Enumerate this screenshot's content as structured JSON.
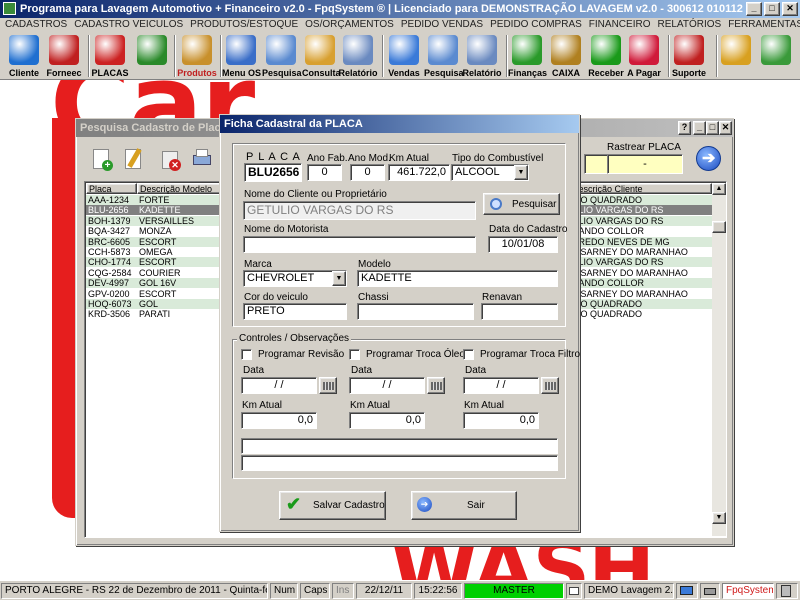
{
  "app": {
    "title": "Programa para Lavagem Automotivo + Financeiro v2.0 - FpqSystem ® | Licenciado para  DEMONSTRAÇÃO LAVAGEM v2.0 - 300612 010112"
  },
  "menu": [
    "CADASTROS",
    "CADASTRO VEICULOS",
    "PRODUTOS/ESTOQUE",
    "OS/ORÇAMENTOS",
    "PEDIDO VENDAS",
    "PEDIDO COMPRAS",
    "FINANCEIRO",
    "RELATÓRIOS",
    "FERRAMENTAS",
    "AJUDA"
  ],
  "toolbar": [
    {
      "label": "Cliente",
      "icon": "person-icon",
      "color": "#1f6fd0"
    },
    {
      "label": "Forneec",
      "icon": "supplier-icon",
      "color": "#c02020"
    },
    {
      "label": "PLACAS",
      "icon": "car-icon",
      "color": "#cc2222"
    },
    {
      "label": "",
      "icon": "clock-icon",
      "color": "#2a8a2a"
    },
    {
      "label": "Produtos",
      "icon": "boxes-icon",
      "color": "#c8902c"
    },
    {
      "label": "Menu OS",
      "icon": "checklist-icon",
      "color": "#3a6ec8"
    },
    {
      "label": "Pesquisa",
      "icon": "magnifier-icon",
      "color": "#5a8ad0"
    },
    {
      "label": "Consulta",
      "icon": "folder-icon",
      "color": "#d8a030"
    },
    {
      "label": "Relatório",
      "icon": "printer-icon",
      "color": "#6a8ac0"
    },
    {
      "label": "Vendas",
      "icon": "monitor-icon",
      "color": "#3a7ad8"
    },
    {
      "label": "Pesquisa",
      "icon": "magnifier-icon",
      "color": "#5a8ad0"
    },
    {
      "label": "Relatório",
      "icon": "printer-icon",
      "color": "#6a8ac0"
    },
    {
      "label": "Finanças",
      "icon": "money-icon",
      "color": "#2a9a2a"
    },
    {
      "label": "CAIXA",
      "icon": "cashbox-icon",
      "color": "#b08020"
    },
    {
      "label": "Receber",
      "icon": "dollar-green-icon",
      "color": "#1a9a1a"
    },
    {
      "label": "A Pagar",
      "icon": "dollar-red-icon",
      "color": "#d01a3a"
    },
    {
      "label": "Suporte",
      "icon": "support-icon",
      "color": "#c02020"
    },
    {
      "label": "",
      "icon": "coin-icon",
      "color": "#d8a020"
    },
    {
      "label": "",
      "icon": "exit-icon",
      "color": "#3a9a3a"
    }
  ],
  "background_logo": {
    "top_text": "Car",
    "bottom_text": "WASH"
  },
  "search_window": {
    "title": "Pesquisa Cadastro de Placas",
    "track_label": "Rastrear PLACA",
    "track_value": "-",
    "columns": [
      "Placa",
      "Descrição Modelo",
      "Descrição Cliente"
    ],
    "rows": [
      {
        "placa": "AAA-1234",
        "modelo": "FORTE",
        "cliente": "VIO QUADRADO"
      },
      {
        "placa": "BLU-2656",
        "modelo": "KADETTE",
        "cliente": "ULIO VARGAS DO RS"
      },
      {
        "placa": "BOH-1379",
        "modelo": "VERSAILLES",
        "cliente": "ULIO VARGAS DO RS"
      },
      {
        "placa": "BQA-3427",
        "modelo": "MONZA",
        "cliente": "NANDO COLLOR"
      },
      {
        "placa": "BRC-6605",
        "modelo": "ESCORT",
        "cliente": "CREDO NEVES DE MG"
      },
      {
        "placa": "CCH-5873",
        "modelo": "OMEGA",
        "cliente": "E SARNEY DO MARANHAO"
      },
      {
        "placa": "CHO-1774",
        "modelo": "ESCORT",
        "cliente": "ULIO VARGAS DO RS"
      },
      {
        "placa": "CQG-2584",
        "modelo": "COURIER",
        "cliente": "E SARNEY DO MARANHAO"
      },
      {
        "placa": "DEV-4997",
        "modelo": "GOL 16V",
        "cliente": "NANDO COLLOR"
      },
      {
        "placa": "GPV-0200",
        "modelo": "ESCORT",
        "cliente": "E SARNEY DO MARANHAO"
      },
      {
        "placa": "HOQ-6073",
        "modelo": "GOL",
        "cliente": "VIO QUADRADO"
      },
      {
        "placa": "KRD-3506",
        "modelo": "PARATI",
        "cliente": "VIO QUADRADO"
      }
    ]
  },
  "dialog": {
    "title": "Ficha Cadastral da PLACA",
    "placa_label": "P L A C A",
    "placa": "BLU2656",
    "ano_fab_label": "Ano Fab.",
    "ano_fab": "0",
    "ano_mod_label": "Ano Mod.",
    "ano_mod": "0",
    "km_label": "Km Atual",
    "km": "461.722,0",
    "combustivel_label": "Tipo do Combustível",
    "combustivel": "ALCOOL",
    "cliente_label": "Nome do Cliente ou Proprietário",
    "cliente": "GETULIO VARGAS DO RS",
    "pesquisar": "Pesquisar",
    "motorista_label": "Nome do Motorista",
    "motorista": "",
    "data_cadastro_label": "Data do Cadastro",
    "data_cadastro": "10/01/08",
    "marca_label": "Marca",
    "marca": "CHEVROLET",
    "modelo_label": "Modelo",
    "modelo": "KADETTE",
    "cor_label": "Cor do veiculo",
    "cor": "PRETO",
    "chassi_label": "Chassi",
    "chassi": "",
    "renavan_label": "Renavan",
    "renavan": "",
    "controles_label": "Controles / Observações",
    "controles": [
      {
        "check": "Programar Revisão",
        "data_label": "Data",
        "data": "/ /",
        "km_label": "Km Atual",
        "km": "0,0"
      },
      {
        "check": "Programar Troca Óleo",
        "data_label": "Data",
        "data": "/ /",
        "km_label": "Km Atual",
        "km": "0,0"
      },
      {
        "check": "Programar Troca Filtro",
        "data_label": "Data",
        "data": "/ /",
        "km_label": "Km Atual",
        "km": "0,0"
      }
    ],
    "obs1": "",
    "obs2": "",
    "salvar": "Salvar Cadastro",
    "sair": "Sair"
  },
  "status": {
    "location": "PORTO ALEGRE - RS 22 de Dezembro de 2011 - Quinta-feira",
    "num": "Num",
    "caps": "Caps",
    "ins": "Ins",
    "date": "22/12/11",
    "time": "15:22:56",
    "user": "MASTER",
    "version": "DEMO Lavagem 2.0",
    "brand": "FpqSystem"
  },
  "colors": {
    "title_active": "#0a246a",
    "selected_row": "#808080",
    "row_alt": "#d9ead9",
    "master_bar": "#00d000",
    "brand_red": "#e61e1e"
  }
}
